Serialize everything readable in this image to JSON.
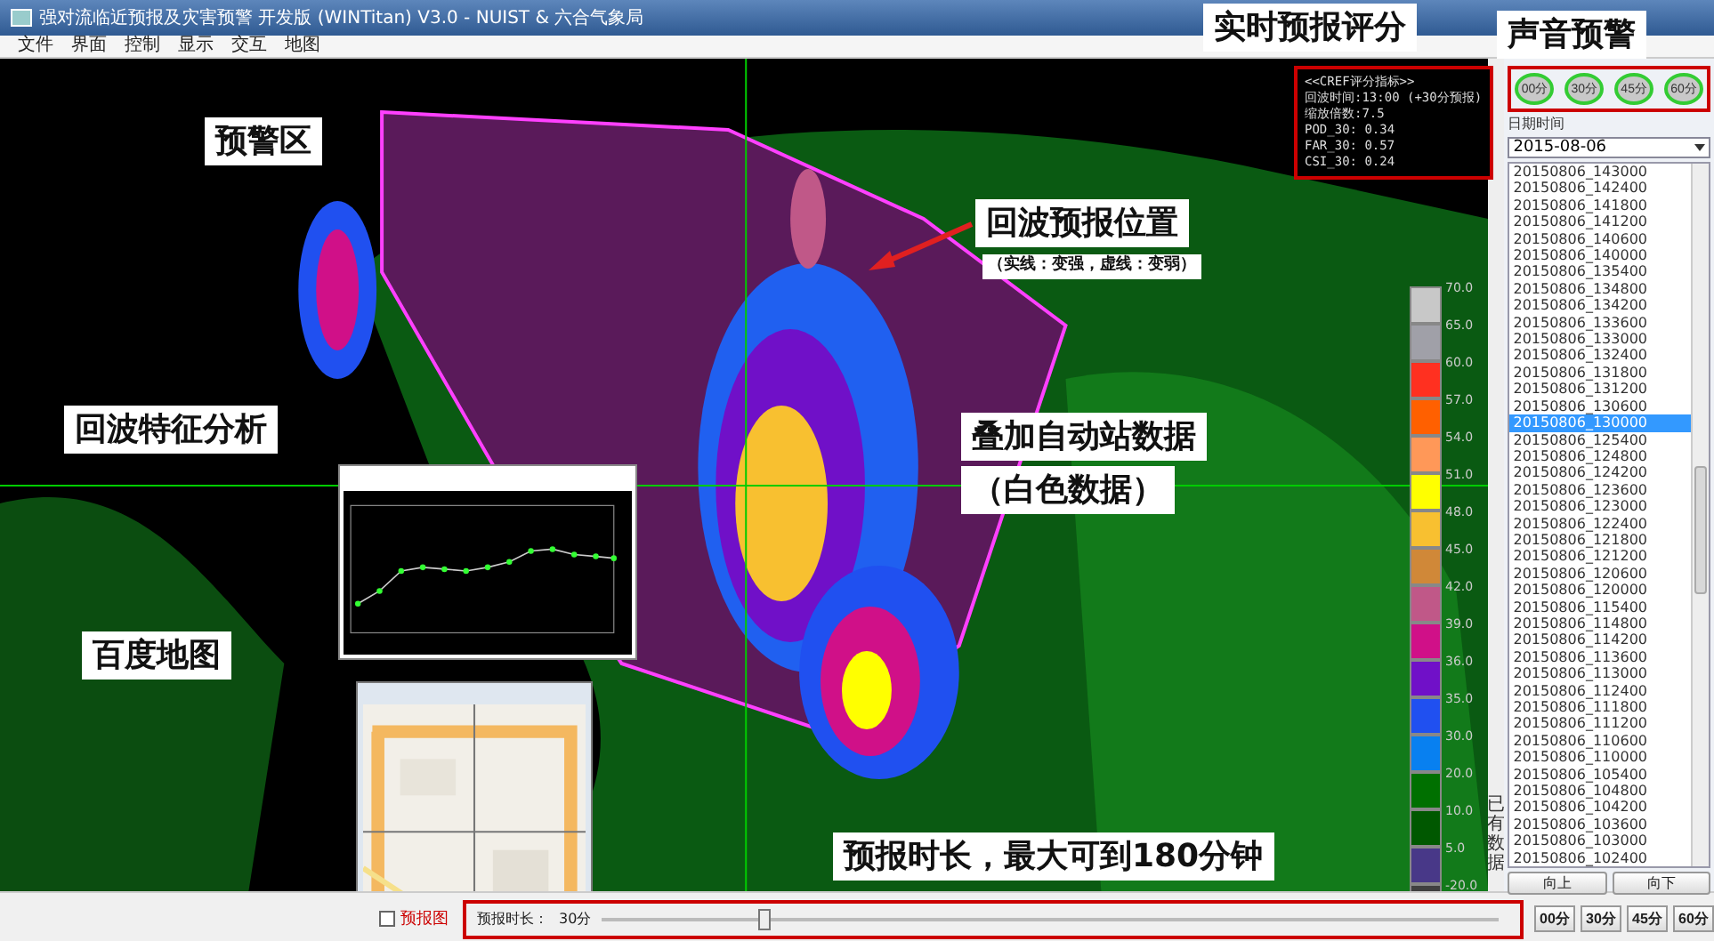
{
  "window": {
    "title": "强对流临近预报及灾害预警 开发版 (WINTitan) V3.0 - NUIST & 六合气象局"
  },
  "menu": [
    "文件",
    "界面",
    "控制",
    "显示",
    "交互",
    "地图"
  ],
  "annotations": [
    {
      "text": "预警区",
      "kind": "label"
    },
    {
      "text": "回波特征分析",
      "kind": "label"
    },
    {
      "text": "百度地图",
      "kind": "label"
    },
    {
      "text": "回波预报位置",
      "kind": "label"
    },
    {
      "text": "（实线：变强，虚线：变弱）",
      "kind": "note"
    },
    {
      "text": "叠加自动站数据",
      "kind": "label"
    },
    {
      "text": "（白色数据）",
      "kind": "label"
    },
    {
      "text": "实时预报评分",
      "kind": "label"
    },
    {
      "text": "声音预警",
      "kind": "label"
    },
    {
      "text": "预报时长，最大可到180分钟",
      "kind": "label"
    }
  ],
  "score_panel": {
    "lines": [
      "<<CREF评分指标>>",
      "回波时间:13:00 (+30分预报)",
      "缩放倍数:7.5",
      "POD_30:  0.34",
      "FAR_30:  0.57",
      "CSI_30:  0.24"
    ]
  },
  "sound_alert": {
    "buttons": [
      "00分",
      "30分",
      "45分",
      "60分"
    ]
  },
  "legend": [
    {
      "label": "70.0",
      "color": "#c8c8c8"
    },
    {
      "label": "65.0",
      "color": "#a0a0a8"
    },
    {
      "label": "60.0",
      "color": "#ff3020"
    },
    {
      "label": "57.0",
      "color": "#ff6000"
    },
    {
      "label": "54.0",
      "color": "#ff9858"
    },
    {
      "label": "51.0",
      "color": "#ffff00"
    },
    {
      "label": "48.0",
      "color": "#f8c030"
    },
    {
      "label": "45.0",
      "color": "#d08838"
    },
    {
      "label": "42.0",
      "color": "#c05888"
    },
    {
      "label": "39.0",
      "color": "#d01088"
    },
    {
      "label": "36.0",
      "color": "#7010c8"
    },
    {
      "label": "35.0",
      "color": "#2050f0"
    },
    {
      "label": "30.0",
      "color": "#0880f0"
    },
    {
      "label": "20.0",
      "color": "#007000"
    },
    {
      "label": "10.0",
      "color": "#005800"
    },
    {
      "label": "5.0",
      "color": "#483888"
    },
    {
      "label": "-20.0",
      "color": "#404040"
    }
  ],
  "date_panel": {
    "label": "日期时间",
    "date": "2015-08-06",
    "vertical_label": "已有数据",
    "times": [
      {
        "label": "20150806_143000",
        "selected": false
      },
      {
        "label": "20150806_142400",
        "selected": false
      },
      {
        "label": "20150806_141800",
        "selected": false
      },
      {
        "label": "20150806_141200",
        "selected": false
      },
      {
        "label": "20150806_140600",
        "selected": false
      },
      {
        "label": "20150806_140000",
        "selected": false
      },
      {
        "label": "20150806_135400",
        "selected": false
      },
      {
        "label": "20150806_134800",
        "selected": false
      },
      {
        "label": "20150806_134200",
        "selected": false
      },
      {
        "label": "20150806_133600",
        "selected": false
      },
      {
        "label": "20150806_133000",
        "selected": false
      },
      {
        "label": "20150806_132400",
        "selected": false
      },
      {
        "label": "20150806_131800",
        "selected": false
      },
      {
        "label": "20150806_131200",
        "selected": false
      },
      {
        "label": "20150806_130600",
        "selected": false
      },
      {
        "label": "20150806_130000",
        "selected": true
      },
      {
        "label": "20150806_125400",
        "selected": false
      },
      {
        "label": "20150806_124800",
        "selected": false
      },
      {
        "label": "20150806_124200",
        "selected": false
      },
      {
        "label": "20150806_123600",
        "selected": false
      },
      {
        "label": "20150806_123000",
        "selected": false
      },
      {
        "label": "20150806_122400",
        "selected": false
      },
      {
        "label": "20150806_121800",
        "selected": false
      },
      {
        "label": "20150806_121200",
        "selected": false
      },
      {
        "label": "20150806_120600",
        "selected": false
      },
      {
        "label": "20150806_120000",
        "selected": false
      },
      {
        "label": "20150806_115400",
        "selected": false
      },
      {
        "label": "20150806_114800",
        "selected": false
      },
      {
        "label": "20150806_114200",
        "selected": false
      },
      {
        "label": "20150806_113600",
        "selected": false
      },
      {
        "label": "20150806_113000",
        "selected": false
      },
      {
        "label": "20150806_112400",
        "selected": false
      },
      {
        "label": "20150806_111800",
        "selected": false
      },
      {
        "label": "20150806_111200",
        "selected": false
      },
      {
        "label": "20150806_110600",
        "selected": false
      },
      {
        "label": "20150806_110000",
        "selected": false
      },
      {
        "label": "20150806_105400",
        "selected": false
      },
      {
        "label": "20150806_104800",
        "selected": false
      },
      {
        "label": "20150806_104200",
        "selected": false
      },
      {
        "label": "20150806_103600",
        "selected": false
      },
      {
        "label": "20150806_103000",
        "selected": false
      },
      {
        "label": "20150806_102400",
        "selected": false
      }
    ],
    "buttons": [
      "向上",
      "向下"
    ]
  },
  "forecast_buttons": [
    "00分",
    "30分",
    "45分",
    "60分"
  ],
  "bottom_bar": {
    "checkbox": {
      "label": "预报图",
      "checked": false
    },
    "duration_label": "预报时长：",
    "duration_value": "30分",
    "slider": {
      "level": 0.18
    }
  }
}
